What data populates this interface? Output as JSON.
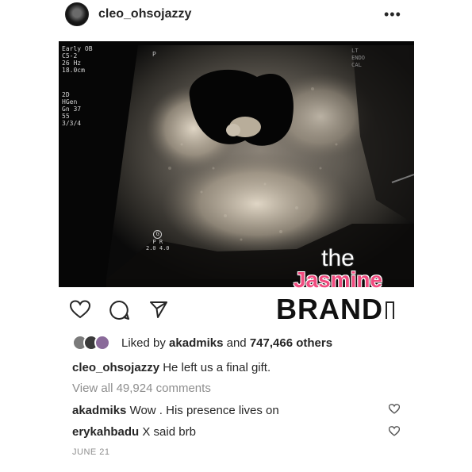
{
  "post": {
    "username": "cleo_ohsojazzy",
    "more_label": "•••",
    "photo": {
      "scan_left_lines": [
        "Early OB",
        "C5-2",
        "26 Hz",
        "18.0cm"
      ],
      "scan_left2_lines": [
        "2D",
        "HGen",
        "Gn 37",
        "55",
        "3/3/4"
      ],
      "scan_marker": "P",
      "scan_right_lines": [
        "LT",
        "ENDO",
        "CAL"
      ],
      "probe_g": "G",
      "probe_pr": "P   R",
      "probe_values": "2.0 4.0"
    },
    "watermark": {
      "the": "the",
      "jasmine": "Jasmine",
      "brand": "BRAND"
    },
    "actions": {
      "like_icon": "heart-icon",
      "comment_icon": "comment-icon",
      "share_icon": "share-icon"
    },
    "likes": {
      "prefix": "Liked by",
      "user": "akadmiks",
      "middle": "and",
      "count": "747,466 others"
    },
    "caption": {
      "user": "cleo_ohsojazzy",
      "text": "He left us a final gift."
    },
    "view_all": "View all 49,924 comments",
    "comments": [
      {
        "user": "akadmiks",
        "text": "Wow . His presence lives on"
      },
      {
        "user": "erykahbadu",
        "text": "X said brb"
      }
    ],
    "date": "JUNE 21"
  }
}
